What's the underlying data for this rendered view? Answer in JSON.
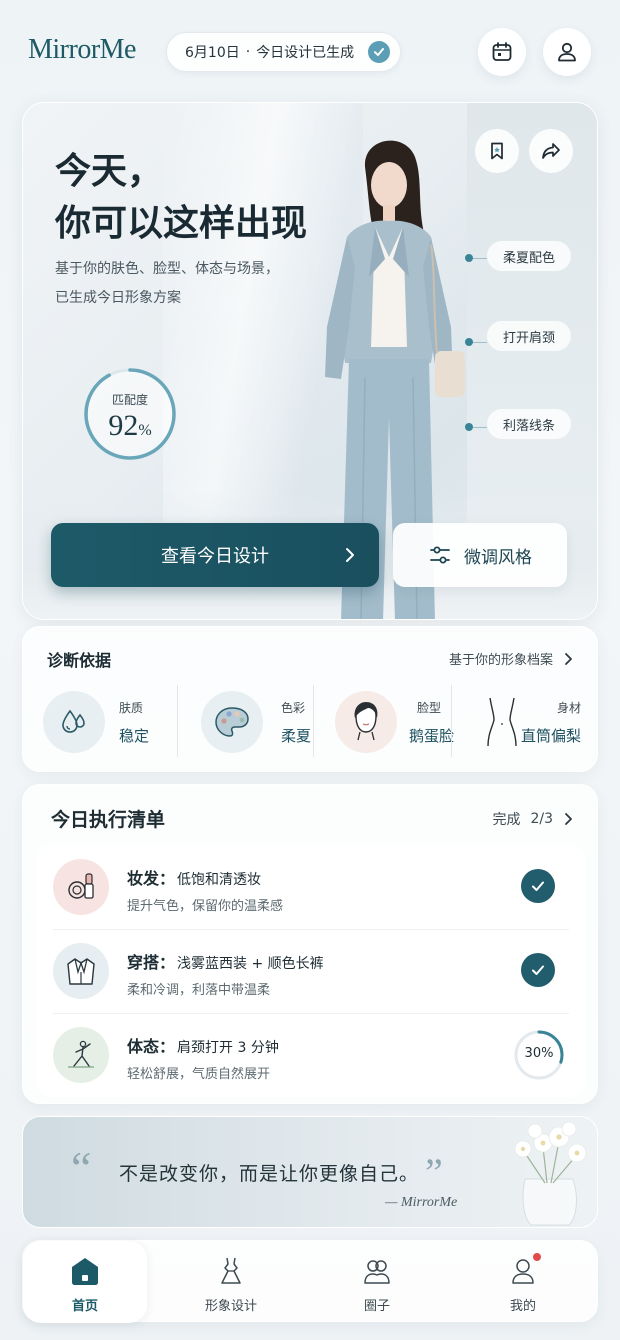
{
  "app": {
    "logo": "MirrorMe"
  },
  "header": {
    "date": "6月10日",
    "separator": "·",
    "status": "今日设计已生成"
  },
  "hero": {
    "title_line1": "今天，",
    "title_line2": "你可以这样出现",
    "subtitle_line1": "基于你的肤色、脸型、体态与场景，",
    "subtitle_line2": "已生成今日形象方案",
    "match_label": "匹配度",
    "match_value": "92",
    "match_unit": "%",
    "match_fraction": 0.92,
    "tags": [
      "柔夏配色",
      "打开肩颈",
      "利落线条"
    ],
    "primary_button": "查看今日设计",
    "secondary_button": "微调风格"
  },
  "diagnosis": {
    "title": "诊断依据",
    "link": "基于你的形象档案",
    "items": [
      {
        "label": "肤质",
        "value": "稳定",
        "icon": "water-drop-icon"
      },
      {
        "label": "色彩",
        "value": "柔夏",
        "icon": "palette-icon"
      },
      {
        "label": "脸型",
        "value": "鹅蛋脸",
        "icon": "face-icon"
      },
      {
        "label": "身材",
        "value": "直筒偏梨",
        "icon": "body-shape-icon"
      }
    ]
  },
  "checklist": {
    "title": "今日执行清单",
    "progress_label": "完成",
    "progress_value": "2/3",
    "items": [
      {
        "category": "妆发：",
        "name": "低饱和清透妆",
        "desc": "提升气色，保留你的温柔感",
        "done": true,
        "icon": "makeup-icon"
      },
      {
        "category": "穿搭：",
        "name": "浅雾蓝西装 + 顺色长裤",
        "desc": "柔和冷调，利落中带温柔",
        "done": true,
        "icon": "jacket-icon"
      },
      {
        "category": "体态：",
        "name": "肩颈打开 3 分钟",
        "desc": "轻松舒展，气质自然展开",
        "done": false,
        "progress": "30%",
        "progress_fraction": 0.3,
        "icon": "yoga-pose-icon"
      }
    ]
  },
  "quote": {
    "text": "不是改变你，而是让你更像自己。",
    "author": "— MirrorMe"
  },
  "nav": {
    "items": [
      {
        "label": "首页",
        "icon": "home-icon",
        "active": true
      },
      {
        "label": "形象设计",
        "icon": "dress-icon",
        "active": false
      },
      {
        "label": "圈子",
        "icon": "community-icon",
        "active": false
      },
      {
        "label": "我的",
        "icon": "user-icon",
        "active": false,
        "badge": true
      }
    ]
  },
  "colors": {
    "primary": "#1d5a68",
    "accent": "#5b9eb6",
    "badge": "#e24b4b"
  }
}
